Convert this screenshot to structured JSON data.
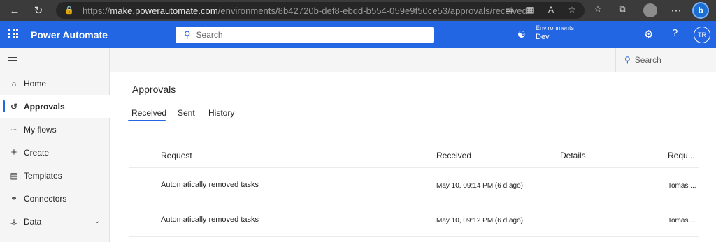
{
  "browser": {
    "url_prefix": "https://",
    "url_host": "make.powerautomate.com",
    "url_path": "/environments/8b42720b-def8-ebdd-b554-059e9f50ce53/approvals/received"
  },
  "header": {
    "app_title": "Power Automate",
    "search_placeholder": "Search",
    "environment_label": "Environments",
    "environment_value": "Dev",
    "user_initials": "TR"
  },
  "sidebar": {
    "items": [
      {
        "label": "Home",
        "icon": "home-icon"
      },
      {
        "label": "Approvals",
        "icon": "approvals-icon"
      },
      {
        "label": "My flows",
        "icon": "flows-icon"
      },
      {
        "label": "Create",
        "icon": "plus-icon"
      },
      {
        "label": "Templates",
        "icon": "templates-icon"
      },
      {
        "label": "Connectors",
        "icon": "connectors-icon"
      },
      {
        "label": "Data",
        "icon": "data-icon"
      }
    ]
  },
  "commandbar": {
    "search_placeholder": "Search"
  },
  "main": {
    "title": "Approvals",
    "tabs": [
      {
        "label": "Received"
      },
      {
        "label": "Sent"
      },
      {
        "label": "History"
      }
    ],
    "table": {
      "columns": [
        "Request",
        "Received",
        "Details",
        "Requ..."
      ],
      "rows": [
        {
          "request": "Automatically removed tasks",
          "received": "May 10, 09:14 PM (6 d ago)",
          "details": "",
          "requester": "Tomas ..."
        },
        {
          "request": "Automatically removed tasks",
          "received": "May 10, 09:12 PM (6 d ago)",
          "details": "",
          "requester": "Tomas ..."
        }
      ]
    }
  },
  "colors": {
    "accent": "#2266e3",
    "browser_chrome": "#3b3b3b",
    "sidebar_bg": "#f5f5f5"
  }
}
